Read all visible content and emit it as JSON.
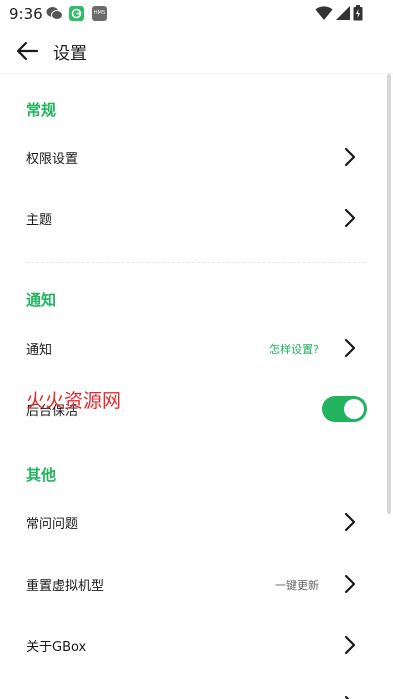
{
  "status_bar": {
    "time": "9:36",
    "app_icons": [
      "wechat-icon",
      "gbox-icon",
      "hms-icon"
    ],
    "hms_text": "HMS",
    "indicators": [
      "wifi-icon",
      "signal-icon",
      "battery-icon"
    ]
  },
  "header": {
    "back_icon": "arrow-left-icon",
    "title": "设置"
  },
  "sections": {
    "general": {
      "title": "常规",
      "items": [
        {
          "label": "权限设置"
        },
        {
          "label": "主题"
        }
      ]
    },
    "notifications": {
      "title": "通知",
      "items": [
        {
          "label": "通知",
          "hint": "怎样设置?"
        },
        {
          "label": "后台保活",
          "toggle_on": true
        }
      ]
    },
    "other": {
      "title": "其他",
      "items": [
        {
          "label": "常问问题"
        },
        {
          "label": "重置虚拟机型",
          "hint": "一键更新"
        },
        {
          "label": "关于GBox"
        }
      ]
    }
  },
  "watermark": "火火资源网",
  "colors": {
    "accent": "#22b35e",
    "watermark": "#e8282c"
  }
}
